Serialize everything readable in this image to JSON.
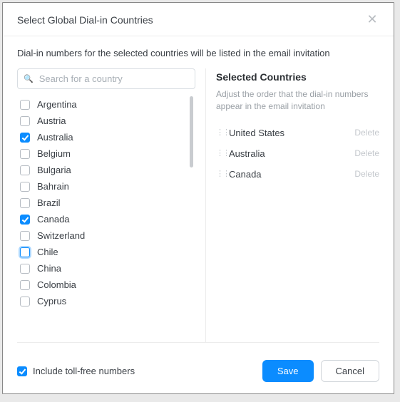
{
  "modal": {
    "title": "Select Global Dial-in Countries",
    "description": "Dial-in numbers for the selected countries will be listed in the email invitation"
  },
  "search": {
    "placeholder": "Search for a country",
    "value": ""
  },
  "countries": [
    {
      "name": "Argentina",
      "checked": false,
      "focused": false
    },
    {
      "name": "Austria",
      "checked": false,
      "focused": false
    },
    {
      "name": "Australia",
      "checked": true,
      "focused": false
    },
    {
      "name": "Belgium",
      "checked": false,
      "focused": false
    },
    {
      "name": "Bulgaria",
      "checked": false,
      "focused": false
    },
    {
      "name": "Bahrain",
      "checked": false,
      "focused": false
    },
    {
      "name": "Brazil",
      "checked": false,
      "focused": false
    },
    {
      "name": "Canada",
      "checked": true,
      "focused": false
    },
    {
      "name": "Switzerland",
      "checked": false,
      "focused": false
    },
    {
      "name": "Chile",
      "checked": false,
      "focused": true
    },
    {
      "name": "China",
      "checked": false,
      "focused": false
    },
    {
      "name": "Colombia",
      "checked": false,
      "focused": false
    },
    {
      "name": "Cyprus",
      "checked": false,
      "focused": false
    }
  ],
  "selectedPanel": {
    "title": "Selected Countries",
    "description": "Adjust the order that the dial-in numbers appear in the email invitation",
    "deleteLabel": "Delete",
    "items": [
      {
        "name": "United States"
      },
      {
        "name": "Australia"
      },
      {
        "name": "Canada"
      }
    ]
  },
  "footer": {
    "tollFreeLabel": "Include toll-free numbers",
    "tollFreeChecked": true,
    "saveLabel": "Save",
    "cancelLabel": "Cancel"
  }
}
